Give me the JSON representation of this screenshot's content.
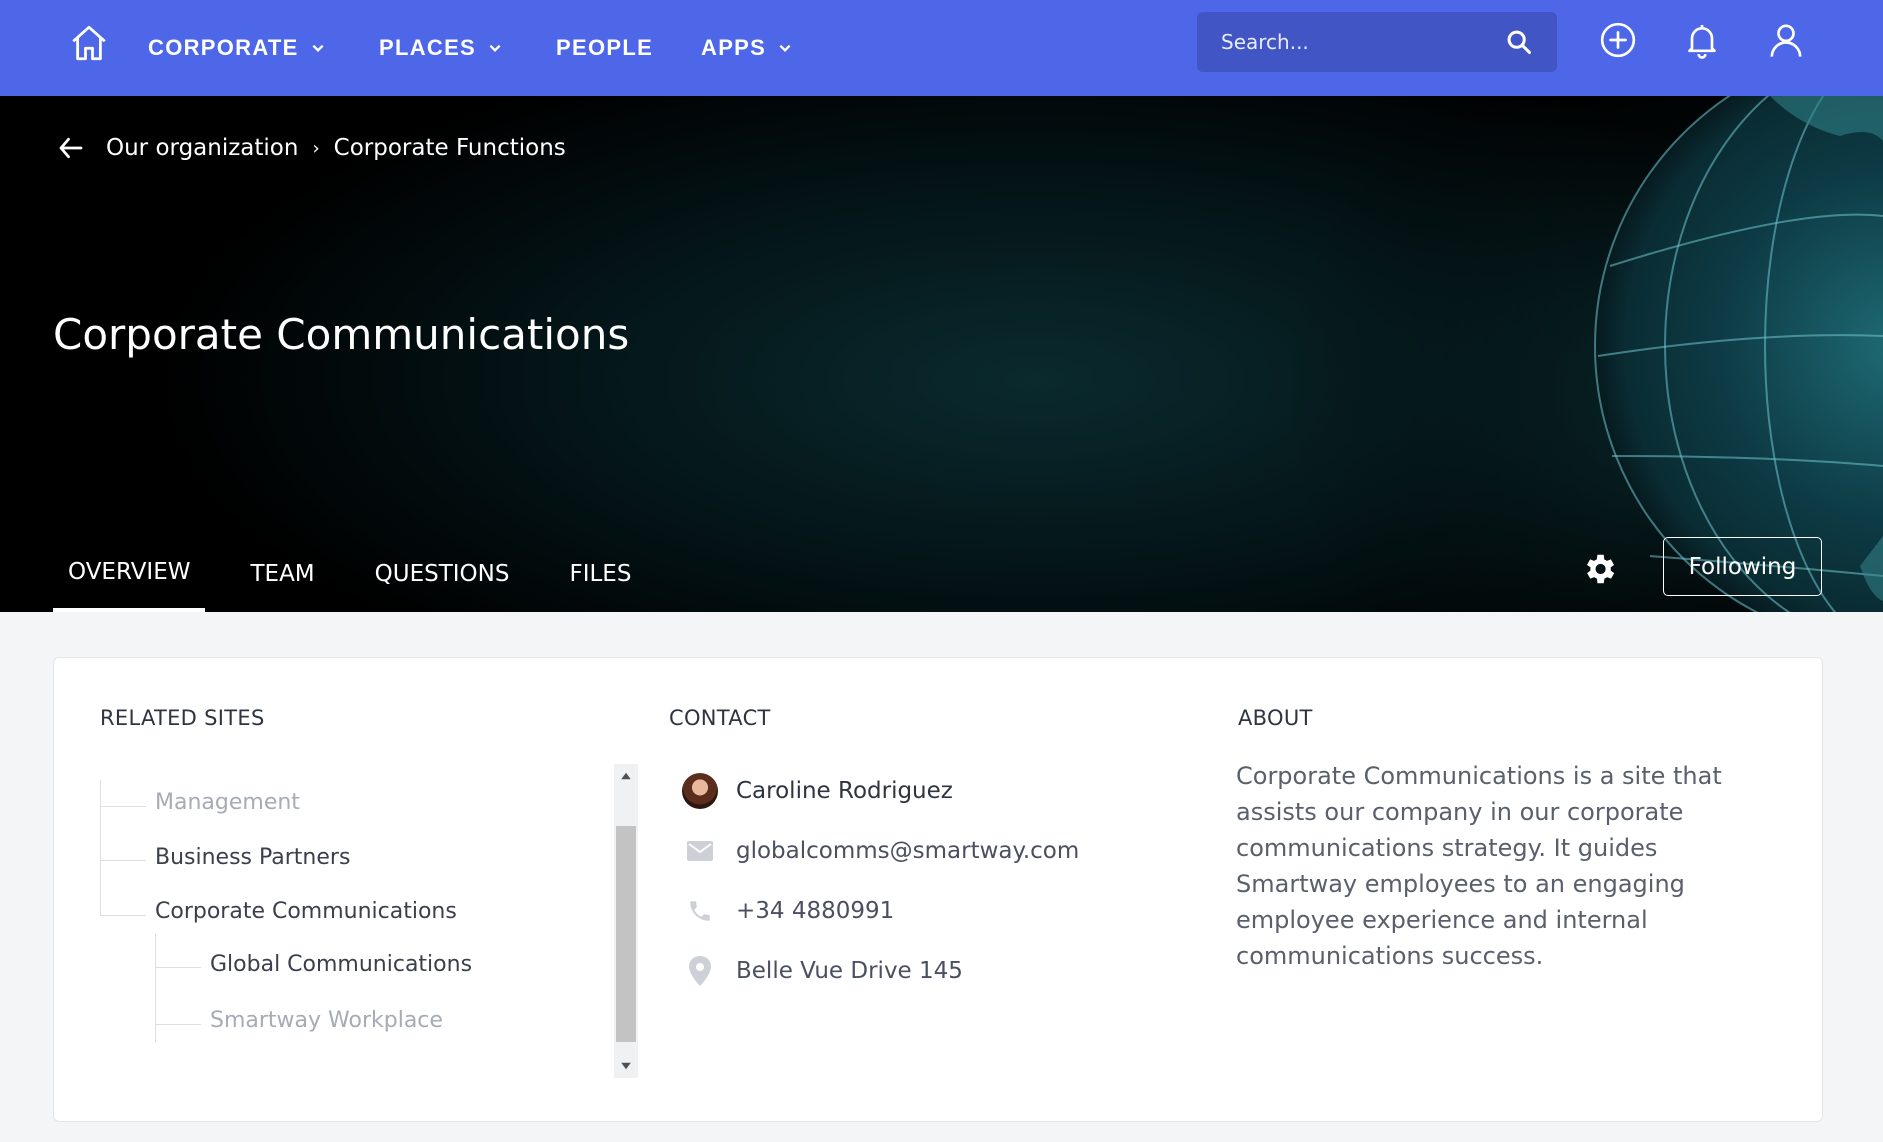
{
  "nav": {
    "items": [
      {
        "label": "CORPORATE",
        "dropdown": true
      },
      {
        "label": "PLACES",
        "dropdown": true
      },
      {
        "label": "PEOPLE",
        "dropdown": false
      },
      {
        "label": "APPS",
        "dropdown": true
      }
    ],
    "search_placeholder": "Search...",
    "icons": [
      "home-icon",
      "search-icon",
      "add-circle-icon",
      "bell-icon",
      "user-icon"
    ]
  },
  "breadcrumb": {
    "items": [
      "Our organization",
      "Corporate Functions"
    ],
    "separator": "›"
  },
  "page": {
    "title": "Corporate Communications"
  },
  "tabs": [
    {
      "label": "OVERVIEW",
      "active": true
    },
    {
      "label": "TEAM",
      "active": false
    },
    {
      "label": "QUESTIONS",
      "active": false
    },
    {
      "label": "FILES",
      "active": false
    }
  ],
  "follow_button": "Following",
  "sections": {
    "related_title": "RELATED SITES",
    "contact_title": "CONTACT",
    "about_title": "ABOUT"
  },
  "related_sites": [
    {
      "label": "Management",
      "level": 0,
      "muted": true
    },
    {
      "label": "Business Partners",
      "level": 0,
      "muted": false
    },
    {
      "label": "Corporate Communications",
      "level": 0,
      "muted": false
    },
    {
      "label": "Global Communications",
      "level": 1,
      "muted": false
    },
    {
      "label": "Smartway Workplace",
      "level": 1,
      "muted": true
    }
  ],
  "contact": {
    "name": "Caroline Rodriguez",
    "email": "globalcomms@smartway.com",
    "phone": "+34 4880991",
    "address": "Belle Vue Drive 145"
  },
  "about": {
    "text": "Corporate Communications is a site that assists our company in our corporate communications strategy. It guides Smartway employees to an engaging employee experience and internal communications success."
  },
  "colors": {
    "nav_bg": "#4e67e8",
    "search_bg": "#4155c4",
    "hero_bg": "#000000",
    "card_bg": "#ffffff",
    "page_bg": "#f4f5f7"
  }
}
